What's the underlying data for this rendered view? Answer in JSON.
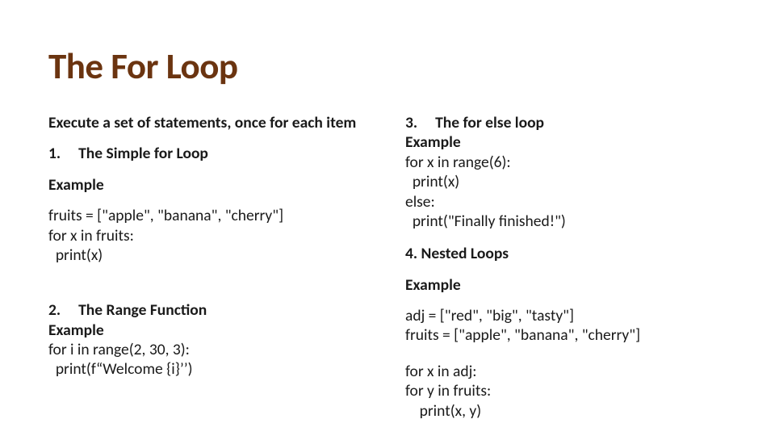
{
  "title": "The For Loop",
  "left": {
    "intro": "Execute a set of statements, once for each item",
    "sec1_num": "1.",
    "sec1_title": "The  Simple for Loop",
    "sec1_example": "Example",
    "sec1_code1": "fruits = [\"apple\", \"banana\", \"cherry\"]",
    "sec1_code2": "for x in fruits:",
    "sec1_code3": "  print(x)",
    "sec2_num": "2.",
    "sec2_title": "The Range Function",
    "sec2_example": "Example",
    "sec2_code1": "for i in range(2, 30, 3):",
    "sec2_code2": "  print(f“Welcome {i}’’)"
  },
  "right": {
    "sec3_num": "3.",
    "sec3_title": "The for else  loop",
    "sec3_example": "Example",
    "sec3_code1": "for x in range(6):",
    "sec3_code2": "  print(x)",
    "sec3_code3": "else:",
    "sec3_code4": "  print(\"Finally finished!\")",
    "sec4_title": "4. Nested Loops",
    "sec4_example": "Example",
    "sec4_code1": "adj = [\"red\", \"big\", \"tasty\"]",
    "sec4_code2": "fruits = [\"apple\", \"banana\", \"cherry\"]",
    "sec4_code3": "for x in adj:",
    "sec4_code4": "for y in fruits:",
    "sec4_code5": "    print(x, y)"
  }
}
